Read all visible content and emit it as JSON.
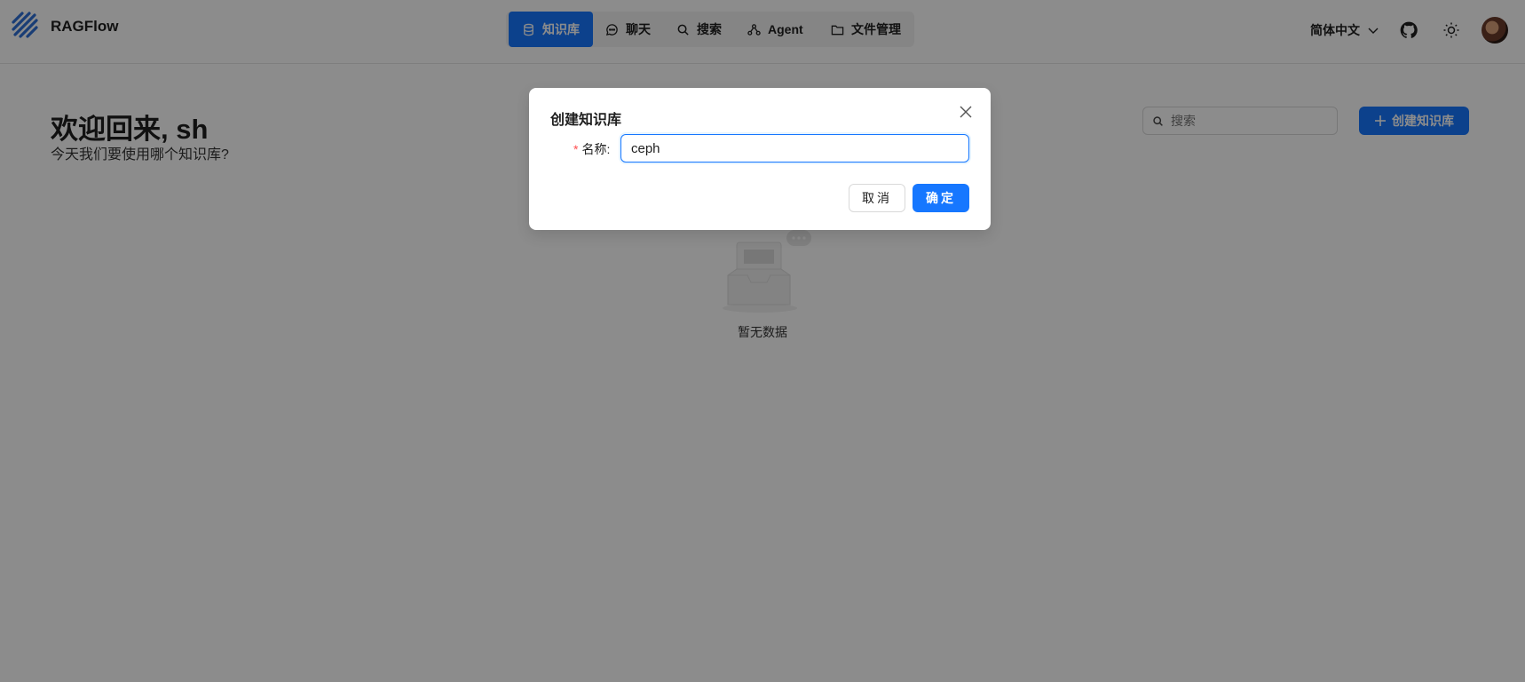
{
  "header": {
    "brand": "RAGFlow",
    "nav": [
      {
        "label": "知识库",
        "icon": "database-icon",
        "active": true
      },
      {
        "label": "聊天",
        "icon": "chat-bubble-icon"
      },
      {
        "label": "搜索",
        "icon": "search-icon"
      },
      {
        "label": "Agent",
        "icon": "agent-graph-icon"
      },
      {
        "label": "文件管理",
        "icon": "folder-icon"
      }
    ],
    "language": "简体中文",
    "icons": [
      "github-icon",
      "sun-icon"
    ]
  },
  "main": {
    "welcome": "欢迎回来, sh",
    "subtitle": "今天我们要使用哪个知识库?",
    "search_placeholder": "搜索",
    "create_button": "创建知识库",
    "empty_text": "暂无数据"
  },
  "modal": {
    "title": "创建知识库",
    "name_label": "名称:",
    "name_value": "ceph",
    "cancel_label": "取消",
    "ok_label": "确定"
  },
  "colors": {
    "primary": "#1677ff",
    "required": "#ff4d4f",
    "mask": "rgba(0,0,0,0.45)"
  }
}
